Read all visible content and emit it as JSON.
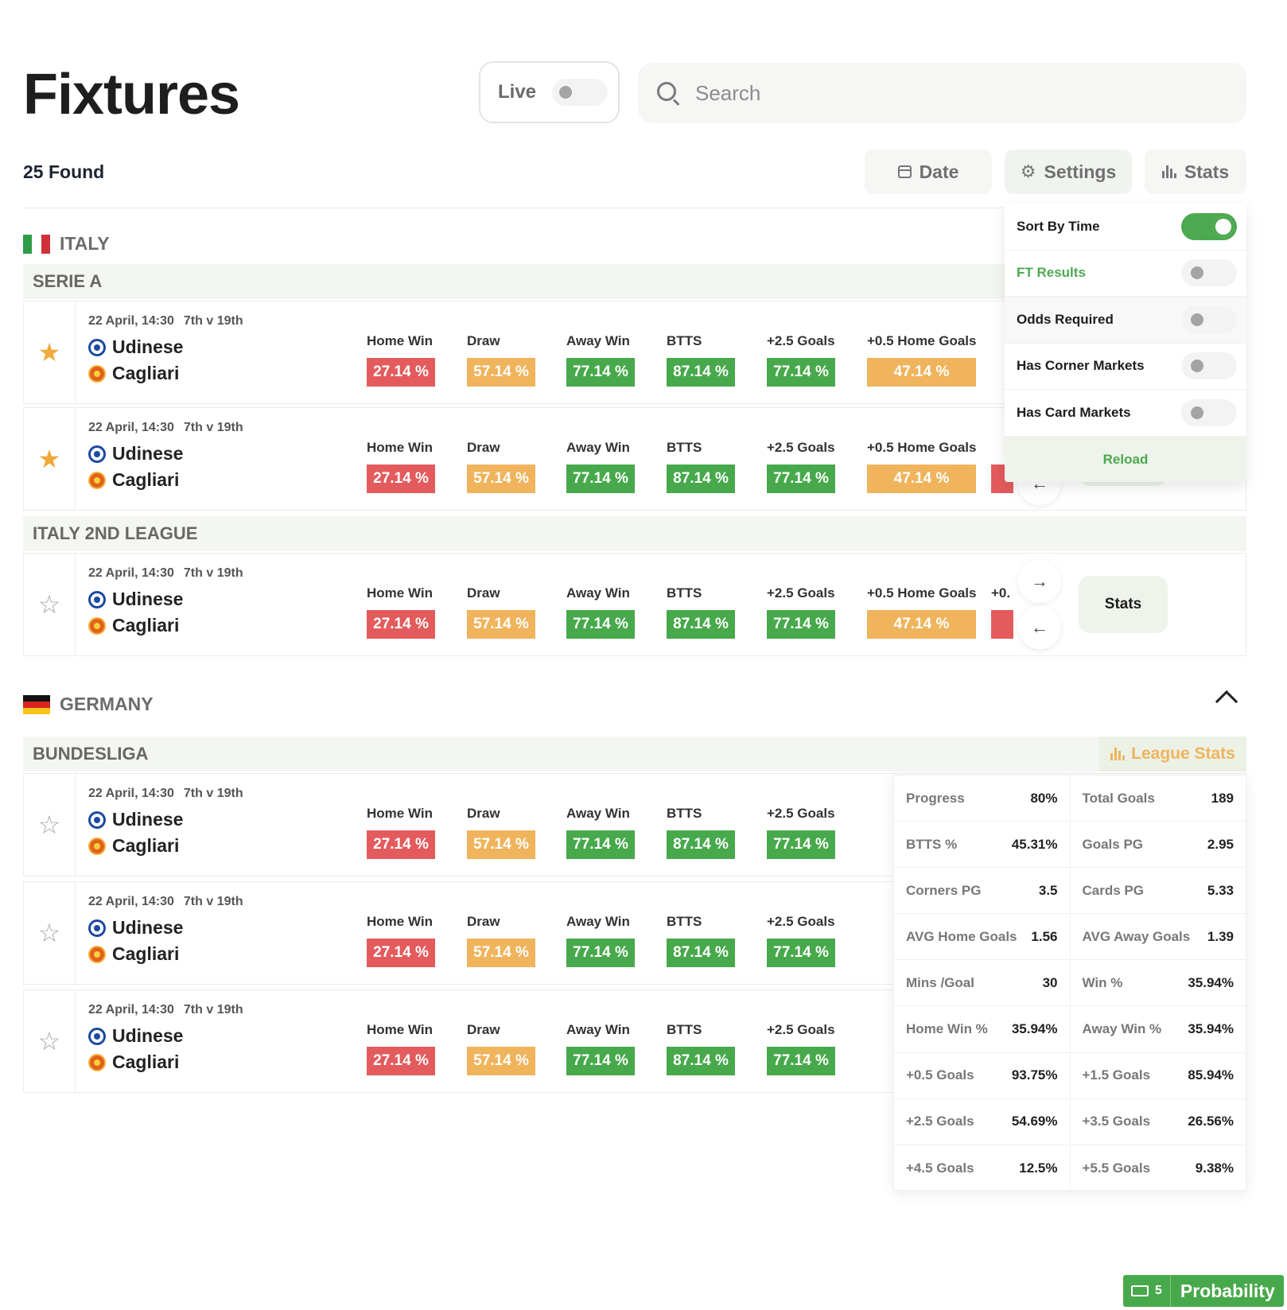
{
  "page": {
    "title": "Fixtures",
    "found": "25 Found"
  },
  "live": {
    "label": "Live",
    "on": false
  },
  "search": {
    "placeholder": "Search"
  },
  "toolbar": {
    "date_label": "Date",
    "settings_label": "Settings",
    "stats_label": "Stats"
  },
  "settings": {
    "items": [
      {
        "label": "Sort By Time",
        "on": true
      },
      {
        "label": "FT Results",
        "on": false
      },
      {
        "label": "Odds Required",
        "on": false
      },
      {
        "label": "Has Corner Markets",
        "on": false
      },
      {
        "label": "Has Card Markets",
        "on": false
      }
    ],
    "reload_label": "Reload"
  },
  "fixture": {
    "meta": "22 April, 14:30",
    "rank": "7th v 19th",
    "home": "Udinese",
    "away": "Cagliari",
    "markets": [
      {
        "label": "Home Win",
        "value": "27.14 %",
        "color": "red"
      },
      {
        "label": "Draw",
        "value": "57.14 %",
        "color": "orange"
      },
      {
        "label": "Away Win",
        "value": "77.14 %",
        "color": "green"
      },
      {
        "label": "BTTS",
        "value": "87.14 %",
        "color": "green"
      },
      {
        "label": "+2.5 Goals",
        "value": "77.14 %",
        "color": "green"
      },
      {
        "label": "+0.5 Home Goals",
        "value": "47.14 %",
        "color": "orange"
      }
    ],
    "partial_label": "+0."
  },
  "arrows": {
    "right": "→",
    "left": "←"
  },
  "stats_button_label": "Stats",
  "countries": {
    "italy": {
      "name": "ITALY",
      "leagues": {
        "serie_a": "SERIE A",
        "second": "ITALY 2ND LEAGUE"
      }
    },
    "germany": {
      "name": "GERMANY",
      "leagues": {
        "bundesliga": "BUNDESLIGA"
      },
      "league_stats_label": "League Stats"
    }
  },
  "league_stats": [
    [
      [
        "Progress",
        "80%"
      ],
      [
        "Total Goals",
        "189"
      ]
    ],
    [
      [
        "BTTS %",
        "45.31%"
      ],
      [
        "Goals PG",
        "2.95"
      ]
    ],
    [
      [
        "Corners PG",
        "3.5"
      ],
      [
        "Cards PG",
        "5.33"
      ]
    ],
    [
      [
        "AVG Home Goals",
        "1.56"
      ],
      [
        "AVG Away Goals",
        "1.39"
      ]
    ],
    [
      [
        "Mins /Goal",
        "30"
      ],
      [
        "Win %",
        "35.94%"
      ]
    ],
    [
      [
        "Home Win %",
        "35.94%"
      ],
      [
        "Away Win %",
        "35.94%"
      ]
    ],
    [
      [
        "+0.5 Goals",
        "93.75%"
      ],
      [
        "+1.5 Goals",
        "85.94%"
      ]
    ],
    [
      [
        "+2.5 Goals",
        "54.69%"
      ],
      [
        "+3.5 Goals",
        "26.56%"
      ]
    ],
    [
      [
        "+4.5 Goals",
        "12.5%"
      ],
      [
        "+5.5 Goals",
        "9.38%"
      ]
    ]
  ],
  "probability": {
    "key_count": "5",
    "label": "Probability"
  },
  "colors": {
    "red": "#e35b5d",
    "orange": "#efb45c",
    "green": "#47a94b",
    "accent": "#4da94f"
  }
}
